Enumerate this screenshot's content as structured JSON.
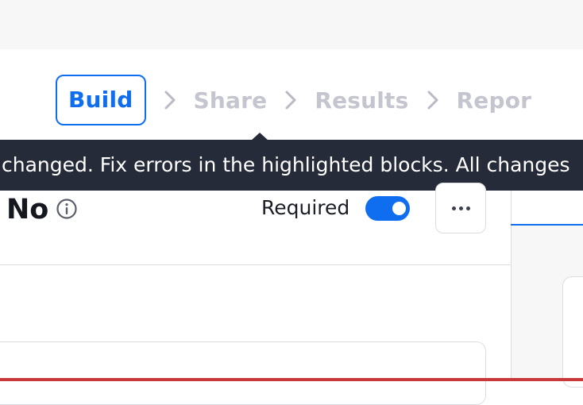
{
  "steps": [
    {
      "label": "Build",
      "active": true
    },
    {
      "label": "Share",
      "active": false
    },
    {
      "label": "Results",
      "active": false
    },
    {
      "label": "Repor",
      "active": false
    }
  ],
  "tooltip": {
    "text": "changed.  Fix errors in the highlighted blocks. All changes"
  },
  "block": {
    "title": "No",
    "required_label": "Required",
    "required_on": true
  },
  "icons": {
    "info": "info-icon",
    "more": "more-options-icon",
    "chevron": "chevron-right-icon"
  },
  "colors": {
    "accent": "#0f6ef0",
    "tooltip_bg": "#262b3a",
    "inactive_step": "#c4c5ce",
    "error": "#c9393c"
  }
}
